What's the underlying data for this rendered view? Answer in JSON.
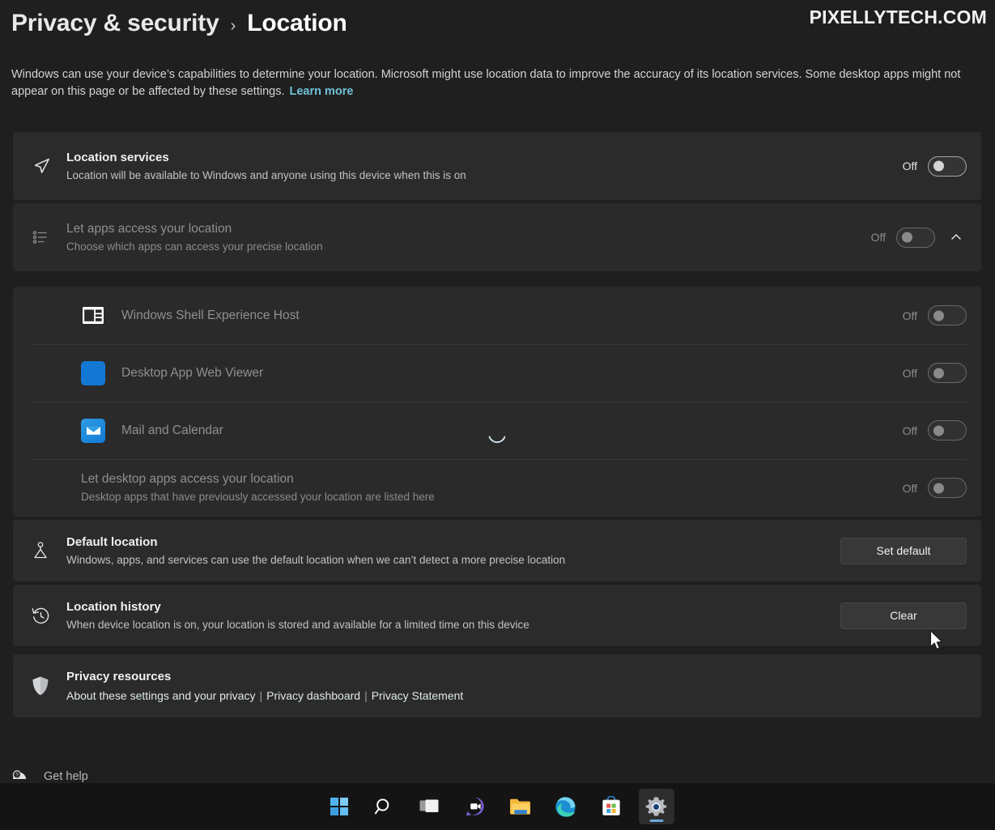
{
  "watermark": "PIXELLYTECH.COM",
  "header": {
    "parent": "Privacy & security",
    "separator": "›",
    "current": "Location"
  },
  "intro": {
    "text": "Windows can use your device’s capabilities to determine your location. Microsoft might use location data to improve the accuracy of its location services. Some desktop apps might not appear on this page or be affected by these settings.",
    "link": "Learn more"
  },
  "settings": {
    "location_services": {
      "title": "Location services",
      "subtitle": "Location will be available to Windows and anyone using this device when this is on",
      "state": "Off",
      "icon": "navigation-arrow-icon"
    },
    "let_apps": {
      "title": "Let apps access your location",
      "subtitle": "Choose which apps can access your precise location",
      "state": "Off",
      "icon": "list-icon",
      "expanded": true
    },
    "apps": [
      {
        "name": "Windows Shell Experience Host",
        "state": "Off",
        "icon": "window-layout-icon"
      },
      {
        "name": "Desktop App Web Viewer",
        "state": "Off",
        "icon": "blue-square-icon"
      },
      {
        "name": "Mail and Calendar",
        "state": "Off",
        "icon": "envelope-icon"
      }
    ],
    "desktop_apps": {
      "title": "Let desktop apps access your location",
      "subtitle": "Desktop apps that have previously accessed your location are listed here",
      "state": "Off"
    },
    "default_location": {
      "title": "Default location",
      "subtitle": "Windows, apps, and services can use the default location when we can’t detect a more precise location",
      "button": "Set default",
      "icon": "map-pin-icon"
    },
    "location_history": {
      "title": "Location history",
      "subtitle": "When device location is on, your location is stored and available for a limited time on this device",
      "button": "Clear",
      "icon": "history-clock-icon"
    },
    "privacy_resources": {
      "title": "Privacy resources",
      "icon": "shield-icon",
      "links": [
        "About these settings and your privacy",
        "Privacy dashboard",
        "Privacy Statement"
      ],
      "separator": "|"
    }
  },
  "footer": {
    "get_help": "Get help"
  },
  "taskbar": {
    "items": [
      {
        "name": "start-button",
        "icon": "windows-logo-icon"
      },
      {
        "name": "search-button",
        "icon": "search-icon"
      },
      {
        "name": "task-view-button",
        "icon": "task-view-icon"
      },
      {
        "name": "chat-button",
        "icon": "chat-video-icon"
      },
      {
        "name": "file-explorer-button",
        "icon": "folder-icon"
      },
      {
        "name": "edge-button",
        "icon": "edge-icon"
      },
      {
        "name": "store-button",
        "icon": "store-bag-icon"
      },
      {
        "name": "settings-button",
        "icon": "gear-icon",
        "active": true
      }
    ]
  },
  "colors": {
    "page_bg": "#1f1f1f",
    "card_bg": "#2b2b2b",
    "accent_link": "#6fc2d8",
    "taskbar_bg": "#141414",
    "active_indicator": "#6aa9e0"
  }
}
